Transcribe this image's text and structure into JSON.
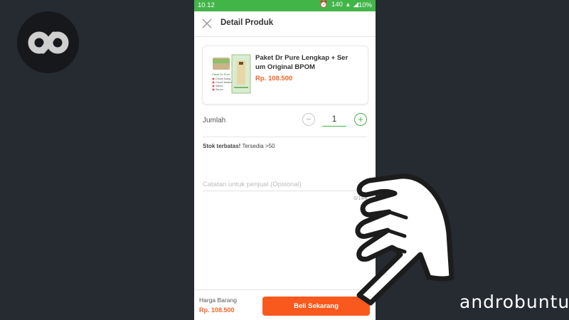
{
  "status_bar": {
    "time": "10.12",
    "signal_text": "140",
    "battery": "10%"
  },
  "header": {
    "title": "Detail Produk",
    "close_icon": "close-icon"
  },
  "product": {
    "name": "Paket Dr Pure Lengkap + Ser um Original BPOM",
    "price": "Rp. 108.500",
    "image_lines": [
      "Paket Dr Pure",
      "Cream Siang",
      "Cream Malam",
      "Sabun",
      "Serum"
    ]
  },
  "quantity": {
    "label": "Jumlah",
    "value": "1",
    "minus_icon": "minus-circle-icon",
    "plus_icon": "plus-circle-icon"
  },
  "stock": {
    "bold": "Stok terbatas!",
    "text": " Tersedia >50"
  },
  "note": {
    "placeholder": "Catatan untuk penjual (Opsional)",
    "counter": "0/144"
  },
  "bottom_bar": {
    "price_label": "Harga Barang",
    "price_value": "Rp. 108.500",
    "buy_label": "Beli Sekarang"
  },
  "branding": {
    "logo_icon": "androbuntu-logo-icon",
    "hand_icon": "pointing-hand-icon",
    "name": "androbuntu"
  },
  "colors": {
    "green": "#42b549",
    "orange": "#fa591d",
    "price": "#f0662a",
    "background": "#262a31"
  }
}
